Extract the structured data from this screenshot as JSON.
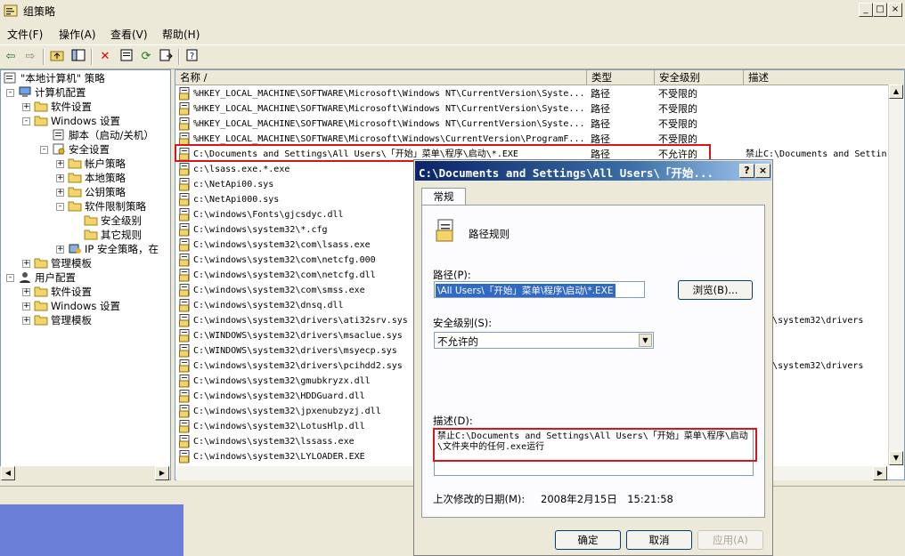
{
  "window": {
    "title": "组策略",
    "controls": {
      "minimize": "_",
      "maximize": "□",
      "close": "×"
    }
  },
  "menu": [
    "文件(F)",
    "操作(A)",
    "查看(V)",
    "帮助(H)"
  ],
  "tree": {
    "root": "\"本地计算机\" 策略",
    "computer_config": "计算机配置",
    "software_settings": "软件设置",
    "windows_settings": "Windows 设置",
    "scripts": "脚本（启动/关机）",
    "security_settings": "安全设置",
    "account_policy": "帐户策略",
    "local_policy": "本地策略",
    "public_key_policy": "公钥策略",
    "software_restriction": "软件限制策略",
    "security_levels": "安全级别",
    "other_rules": "其它规则",
    "ip_security": "IP 安全策略，在",
    "admin_templates": "管理模板",
    "user_config": "用户配置",
    "user_software_settings": "软件设置",
    "user_windows_settings": "Windows 设置",
    "user_admin_templates": "管理模板"
  },
  "list": {
    "columns": [
      "名称 /",
      "类型",
      "安全级别",
      "描述"
    ],
    "rows": [
      {
        "name": "%HKEY_LOCAL_MACHINE\\SOFTWARE\\Microsoft\\Windows NT\\CurrentVersion\\Syste...",
        "type": "路径",
        "level": "不受限的",
        "desc": ""
      },
      {
        "name": "%HKEY_LOCAL_MACHINE\\SOFTWARE\\Microsoft\\Windows NT\\CurrentVersion\\Syste...",
        "type": "路径",
        "level": "不受限的",
        "desc": ""
      },
      {
        "name": "%HKEY_LOCAL_MACHINE\\SOFTWARE\\Microsoft\\Windows NT\\CurrentVersion\\Syste...",
        "type": "路径",
        "level": "不受限的",
        "desc": ""
      },
      {
        "name": "%HKEY_LOCAL_MACHINE\\SOFTWARE\\Microsoft\\Windows\\CurrentVersion\\ProgramF...",
        "type": "路径",
        "level": "不受限的",
        "desc": ""
      },
      {
        "name": "C:\\Documents and Settings\\All Users\\「开始」菜单\\程序\\启动\\*.EXE",
        "type": "路径",
        "level": "不允许的",
        "desc": "禁止C:\\Documents and Settin"
      },
      {
        "name": "c:\\lsass.exe.*.exe",
        "type": "",
        "level": "",
        "desc": ""
      },
      {
        "name": "c:\\NetApi00.sys",
        "type": "",
        "level": "",
        "desc": ""
      },
      {
        "name": "c:\\NetApi000.sys",
        "type": "",
        "level": "",
        "desc": ""
      },
      {
        "name": "C:\\windows\\Fonts\\gjcsdyc.dll",
        "type": "",
        "level": "",
        "desc": ""
      },
      {
        "name": "C:\\windows\\system32\\*.cfg",
        "type": "",
        "level": "",
        "desc": ""
      },
      {
        "name": "C:\\windows\\system32\\com\\lsass.exe",
        "type": "",
        "level": "",
        "desc": ""
      },
      {
        "name": "C:\\windows\\system32\\com\\netcfg.000",
        "type": "",
        "level": "",
        "desc": ""
      },
      {
        "name": "C:\\windows\\system32\\com\\netcfg.dll",
        "type": "",
        "level": "",
        "desc": ""
      },
      {
        "name": "C:\\windows\\system32\\com\\smss.exe",
        "type": "",
        "level": "",
        "desc": ""
      },
      {
        "name": "C:\\windows\\system32\\dnsq.dll",
        "type": "",
        "level": "",
        "desc": ""
      },
      {
        "name": "C:\\windows\\system32\\drivers\\ati32srv.sys",
        "type": "",
        "level": "",
        "desc": "ndows\\system32\\drivers"
      },
      {
        "name": "C:\\WINDOWS\\system32\\drivers\\msaclue.sys",
        "type": "",
        "level": "",
        "desc": ""
      },
      {
        "name": "C:\\WINDOWS\\system32\\drivers\\msyecp.sys",
        "type": "",
        "level": "",
        "desc": ""
      },
      {
        "name": "C:\\windows\\system32\\drivers\\pcihdd2.sys",
        "type": "",
        "level": "",
        "desc": "ndows\\system32\\drivers"
      },
      {
        "name": "C:\\windows\\system32\\gmubkryzx.dll",
        "type": "",
        "level": "",
        "desc": ""
      },
      {
        "name": "C:\\windows\\system32\\HDDGuard.dll",
        "type": "",
        "level": "",
        "desc": ""
      },
      {
        "name": "C:\\windows\\system32\\jpxenubzyzj.dll",
        "type": "",
        "level": "",
        "desc": ""
      },
      {
        "name": "C:\\windows\\system32\\LotusHlp.dll",
        "type": "",
        "level": "",
        "desc": ""
      },
      {
        "name": "C:\\windows\\system32\\lssass.exe",
        "type": "",
        "level": "",
        "desc": ""
      },
      {
        "name": "C:\\windows\\system32\\LYLOADER.EXE",
        "type": "",
        "level": "",
        "desc": ""
      }
    ]
  },
  "dialog": {
    "title": "C:\\Documents and Settings\\All Users\\「开始...",
    "help": "?",
    "close": "×",
    "tab": "常规",
    "rule_type": "路径规则",
    "path_label": "路径(P):",
    "path_value": "\\All Users\\「开始」菜单\\程序\\启动\\*.EXE",
    "browse": "浏览(B)...",
    "level_label": "安全级别(S):",
    "level_value": "不允许的",
    "desc_label": "描述(D):",
    "desc_value": "禁止C:\\Documents and Settings\\All Users\\「开始」菜单\\程序\\启动\\文件夹中的任何.exe运行",
    "modified_label": "上次修改的日期(M):",
    "modified_value": "2008年2月15日　15:21:58",
    "ok": "确定",
    "cancel": "取消",
    "apply": "应用(A)"
  }
}
